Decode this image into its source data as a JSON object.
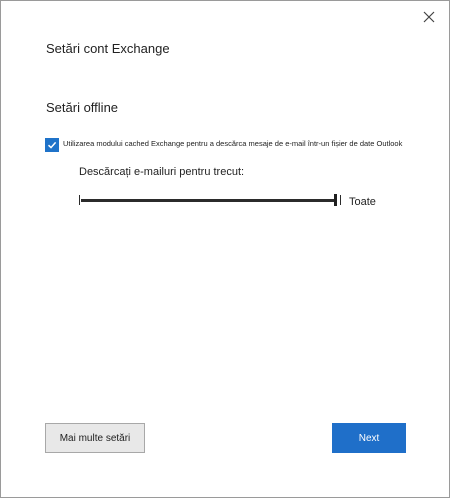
{
  "dialog": {
    "title": "Setări cont Exchange",
    "section_title": "Setări offline",
    "cached_mode": {
      "checked": true,
      "label": "Utilizarea modului cached Exchange pentru a descărca mesaje de e-mail într-un fișier de date Outlook"
    },
    "download_slider": {
      "label": "Descărcați e-mailuri pentru trecut:",
      "value": "Toate",
      "position_fraction": 1.0
    },
    "buttons": {
      "more_settings": "Mai multe setări",
      "next": "Next"
    }
  },
  "colors": {
    "accent": "#1f6fc9",
    "checkbox": "#1f73c9",
    "border": "#9a9a9a"
  },
  "icons": {
    "close": "close-icon",
    "check": "checkmark-icon"
  }
}
